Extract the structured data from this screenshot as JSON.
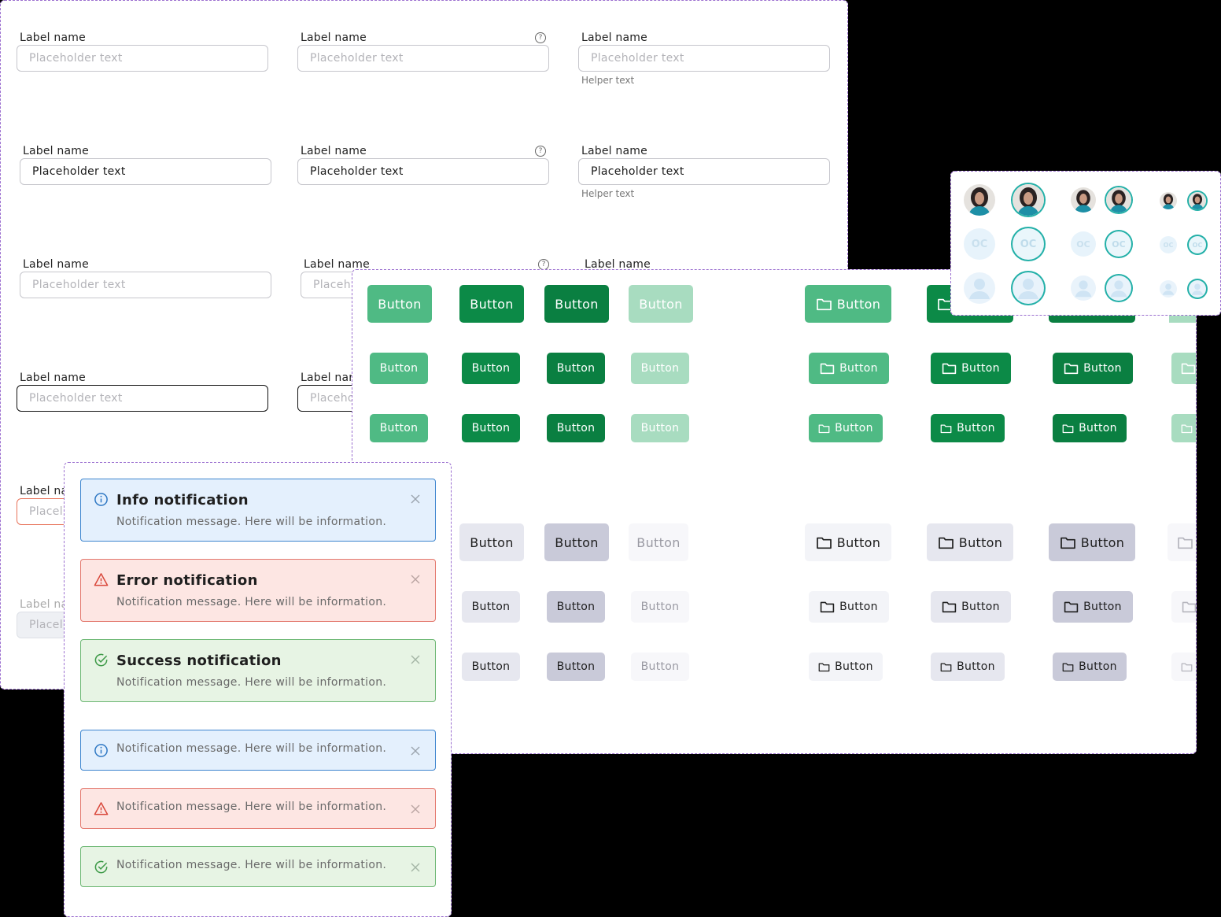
{
  "inputs": {
    "label": "Label name",
    "placeholder": "Placeholder text",
    "value": "Placeholder text",
    "helper": "Helper text",
    "label_cut_1": "Label nar",
    "label_cut_2": "Label na",
    "ph_cut_1": "Placeh",
    "ph_cut_2": "Placeho",
    "ph_cut_3": "Placel",
    "ph_cut_4": "Placel",
    "help_icon": "question-circle-icon"
  },
  "buttons": {
    "label": "Button",
    "colors": {
      "primary": "#4fba84",
      "primary_dark": "#0c8a47",
      "disabled": "#a8dcc0",
      "neutral": "#e6e7ef"
    },
    "icon": "folder-icon"
  },
  "notifications": {
    "info_title": "Info notification",
    "error_title": "Error notification",
    "success_title": "Success notification",
    "message": "Notification message. Here will be information."
  },
  "avatars": {
    "initials": "OC"
  }
}
